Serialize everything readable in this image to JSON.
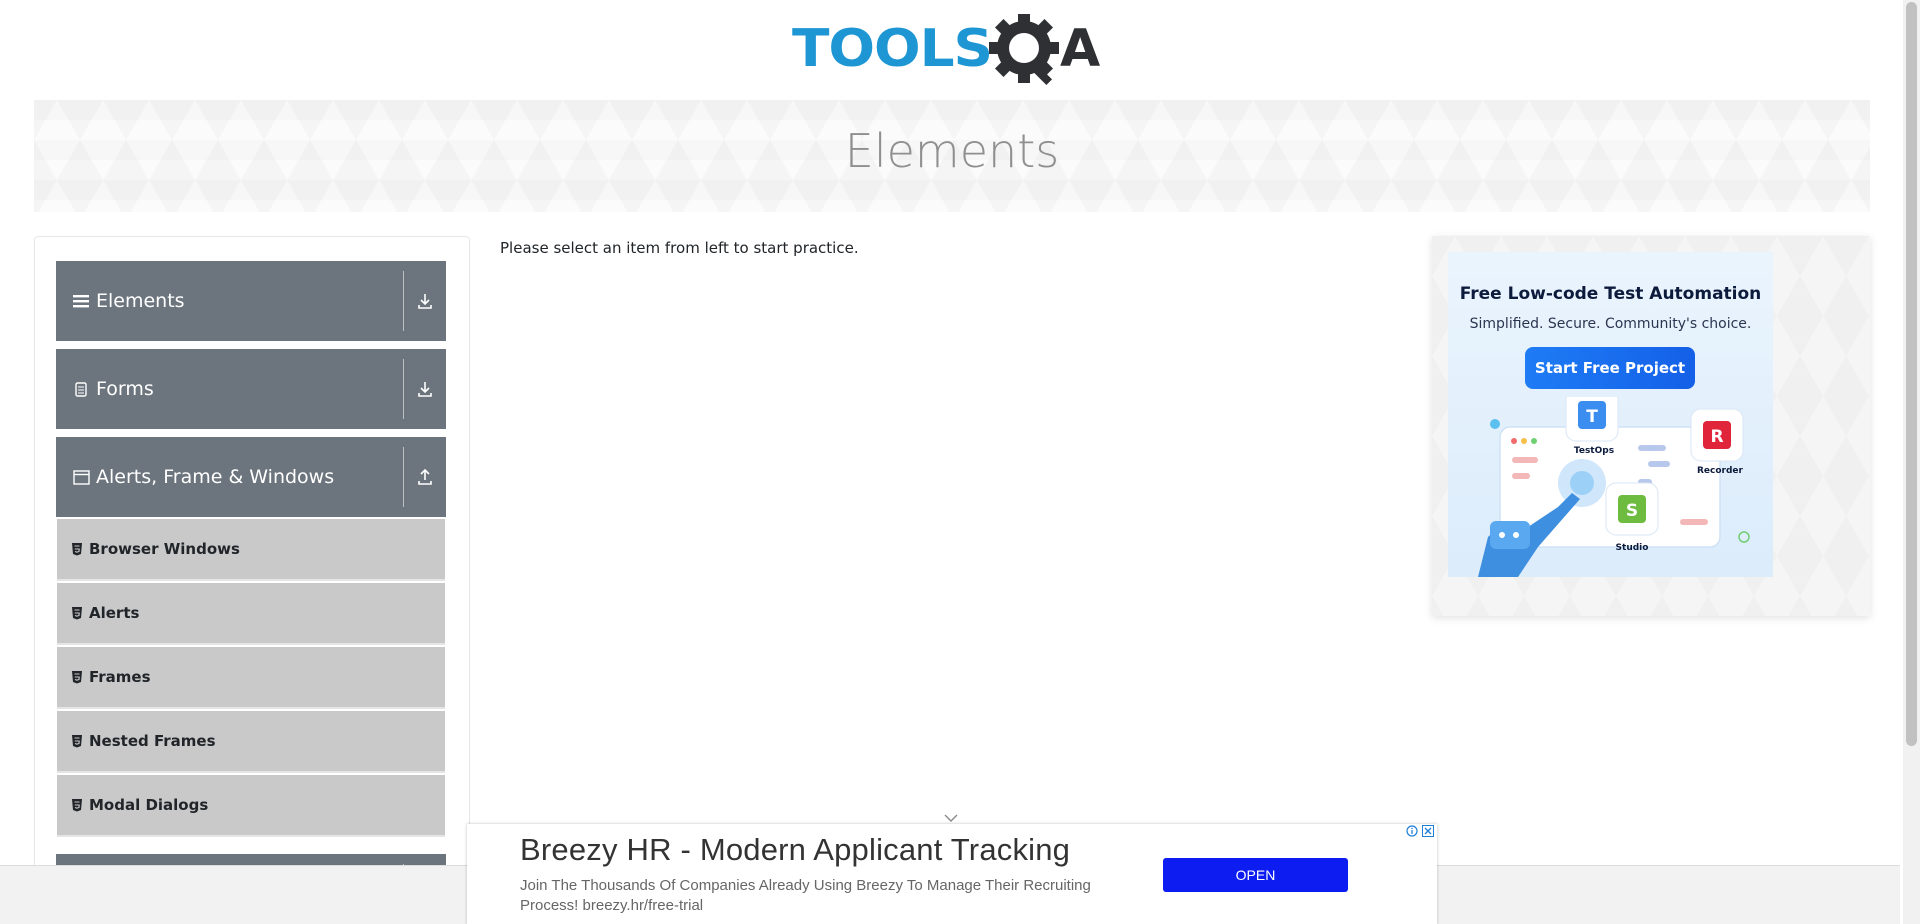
{
  "header": {
    "logo_text_left": "TOOLS",
    "logo_text_right": "A"
  },
  "banner": {
    "title": "Elements"
  },
  "sidebar": {
    "groups": [
      {
        "label": "Elements",
        "icon": "hamburger-icon",
        "toggle_icon": "download-arrow-icon",
        "expanded": false
      },
      {
        "label": "Forms",
        "icon": "document-icon",
        "toggle_icon": "download-arrow-icon",
        "expanded": false
      },
      {
        "label": "Alerts, Frame & Windows",
        "icon": "window-icon",
        "toggle_icon": "upload-arrow-icon",
        "expanded": true
      }
    ],
    "sub_items": [
      {
        "label": "Browser Windows",
        "icon": "html5-icon"
      },
      {
        "label": "Alerts",
        "icon": "html5-icon"
      },
      {
        "label": "Frames",
        "icon": "html5-icon"
      },
      {
        "label": "Nested Frames",
        "icon": "html5-icon"
      },
      {
        "label": "Modal Dialogs",
        "icon": "html5-icon"
      }
    ]
  },
  "main": {
    "instruction": "Please select an item from left to start practice."
  },
  "right_ad": {
    "title": "Free Low-code Test Automation",
    "subtitle": "Simplified. Secure. Community's choice.",
    "button": "Start Free Project",
    "apps": [
      {
        "name": "TestOps",
        "letter": "T",
        "color": "#3b8ef0"
      },
      {
        "name": "Recorder",
        "letter": "R",
        "color": "#e0243a"
      },
      {
        "name": "Studio",
        "letter": "S",
        "color": "#6dbb3f"
      }
    ]
  },
  "bottom_ad": {
    "headline": "Breezy HR - Modern Applicant Tracking",
    "description": "Join The Thousands Of Companies Already Using Breezy To Manage Their Recruiting Process! breezy.hr/free-trial",
    "button": "OPEN"
  },
  "colors": {
    "logo_blue": "#1d96d3",
    "logo_dark": "#2f3033",
    "group_bg": "#6c757d",
    "sub_item_bg": "#c9c9c9",
    "ad_button": "#0d1df2"
  }
}
